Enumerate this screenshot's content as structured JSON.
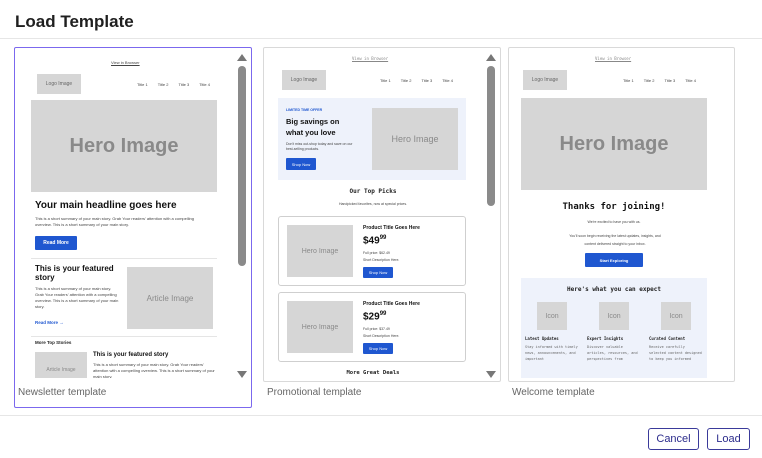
{
  "dialog": {
    "title": "Load Template",
    "cancel_label": "Cancel",
    "load_label": "Load"
  },
  "templates": [
    {
      "label": "Newsletter template",
      "selected": true,
      "view_browser": "View in Browser",
      "logo": "Logo Image",
      "nav": [
        "Title 1",
        "Title 2",
        "Title 3",
        "Title 4"
      ],
      "hero": "Hero Image",
      "headline": "Your main headline goes here",
      "intro": "This is a short summary of your main story. Grab Your readers' attention with a compelling overview. This is a short summary of your main story.",
      "read_more_btn": "Read More",
      "featured_title": "This is your featured story",
      "featured_text": "This is a short summary of your main story. Grab Your readers' attention with a compelling overview. This is a short summary of your main story.",
      "featured_link": "Read More →",
      "article_image": "Article Image",
      "more_stories": "More Top Stories",
      "story2_title": "This is your featured story",
      "story2_text": "This is a short summary of your main story. Grab Your readers' attention with a compelling overview. This is a short summary of your main story.",
      "article_image2": "Article Image"
    },
    {
      "label": "Promotional template",
      "view_browser": "View in Browser",
      "logo": "Logo Image",
      "nav": [
        "Title 1",
        "Title 2",
        "Title 3",
        "Title 4"
      ],
      "offer_tag": "LIMITED TIME OFFER",
      "offer_title": "Big savings on what you love",
      "offer_text": "Don't miss out-shop today and save on our best-selling products.",
      "shop_now": "Shop Now",
      "hero": "Hero Image",
      "top_picks": "Our Top Picks",
      "top_picks_sub": "Handpicked favorites, now at special prices.",
      "products": [
        {
          "hero": "Hero Image",
          "title": "Product Title Goes Here",
          "price_main": "$49",
          "price_cents": "99",
          "full_price": "Full price: $62.49",
          "desc": "Short Description Here.",
          "btn": "Shop Now"
        },
        {
          "hero": "Hero Image",
          "title": "Product Title Goes Here",
          "price_main": "$29",
          "price_cents": "99",
          "full_price": "Full price: $37.49",
          "desc": "Short Description Here.",
          "btn": "Shop Now"
        }
      ],
      "more_deals": "More Great Deals"
    },
    {
      "label": "Welcome template",
      "view_browser": "View in Browser",
      "logo": "Logo Image",
      "nav": [
        "Title 1",
        "Title 2",
        "Title 3",
        "Title 4"
      ],
      "hero": "Hero Image",
      "thanks": "Thanks for joining!",
      "excited": "We're excited to have you with us.",
      "body": "You'll soon begin receiving the latest updates, insights, and content delivered straight to your inbox.",
      "start_btn": "Start Exploring",
      "expect_title": "Here's what you can expect",
      "features": [
        {
          "icon": "Icon",
          "title": "Latest Updates",
          "text": "Stay informed with timely news, announcements, and important"
        },
        {
          "icon": "Icon",
          "title": "Expert Insights",
          "text": "Discover valuable articles, resources, and perspectives from"
        },
        {
          "icon": "Icon",
          "title": "Curated Content",
          "text": "Receive carefully selected content designed to keep you informed"
        }
      ]
    }
  ],
  "colors": {
    "accent": "#7b68ee",
    "primary_button": "#1f57d0",
    "button_border": "#3a3a9a",
    "placeholder_bg": "#d6d6d6"
  }
}
